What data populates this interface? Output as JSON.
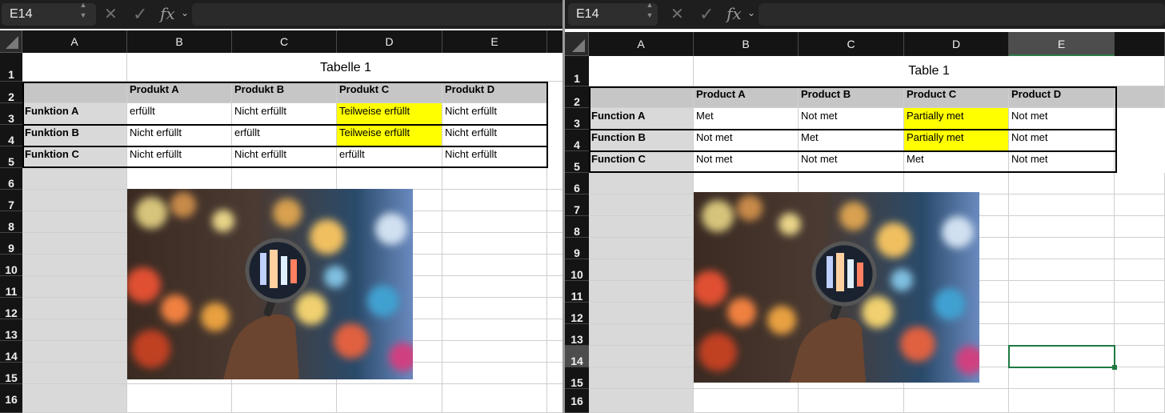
{
  "left": {
    "name_box": "E14",
    "columns": [
      "A",
      "B",
      "C",
      "D",
      "E"
    ],
    "rows": [
      "1",
      "2",
      "3",
      "4",
      "5",
      "6",
      "7",
      "8",
      "9",
      "10",
      "11",
      "12",
      "13",
      "14",
      "15",
      "16"
    ],
    "table_title": "Tabelle 1",
    "headers": [
      "Produkt A",
      "Produkt B",
      "Produkt C",
      "Produkt D"
    ],
    "row_labels": [
      "Funktion A",
      "Funktion B",
      "Funktion C"
    ],
    "cells": [
      [
        "erfüllt",
        "Nicht erfüllt",
        "Teilweise erfüllt",
        "Nicht erfüllt"
      ],
      [
        "Nicht erfüllt",
        "erfüllt",
        "Teilweise erfüllt",
        "Nicht erfüllt"
      ],
      [
        "Nicht erfüllt",
        "Nicht erfüllt",
        "erfüllt",
        "Nicht erfüllt"
      ]
    ]
  },
  "right": {
    "name_box": "E14",
    "columns": [
      "A",
      "B",
      "C",
      "D",
      "E"
    ],
    "rows": [
      "1",
      "2",
      "3",
      "4",
      "5",
      "6",
      "7",
      "8",
      "9",
      "10",
      "11",
      "12",
      "13",
      "14",
      "15",
      "16"
    ],
    "table_title": "Table 1",
    "headers": [
      "Product A",
      "Product B",
      "Product C",
      "Product D"
    ],
    "row_labels": [
      "Function A",
      "Function B",
      "Function C"
    ],
    "cells": [
      [
        "Met",
        "Not met",
        "Partially met",
        "Not met"
      ],
      [
        "Not met",
        "Met",
        "Partially met",
        "Not met"
      ],
      [
        "Not met",
        "Not met",
        "Met",
        "Not met"
      ]
    ],
    "selected_column": "E",
    "selected_row": "14"
  },
  "highlight_color": "#ffff00",
  "selection_color": "#1e7a43",
  "icons": {
    "cancel": "close-icon",
    "confirm": "check-icon",
    "function": "fx-icon"
  },
  "glyphs": {
    "cancel": "✕",
    "confirm": "✓",
    "fx": "fx",
    "chevron": "⌄",
    "spin_up": "▲",
    "spin_down": "▼"
  }
}
